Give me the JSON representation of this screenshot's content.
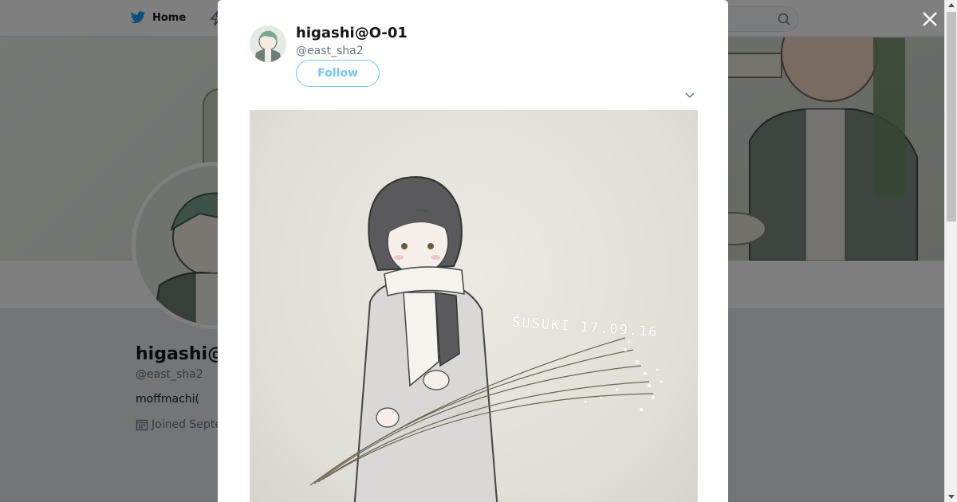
{
  "nav": {
    "home_label": "Home"
  },
  "profile": {
    "name_visible": "higashi@",
    "handle": "@east_sha2",
    "bio_visible": "moffmachi(",
    "joined_visible": "Joined Septe"
  },
  "tweet_modal": {
    "author_name": "higashi@O-01",
    "author_handle": "@east_sha2",
    "follow_label": "Follow",
    "image_caption": "SUSUKI 17.09.16"
  },
  "icons": {
    "close": "close-icon",
    "caret": "chevron-down-icon",
    "search": "search-icon",
    "bird": "twitter-bird-icon",
    "calendar": "calendar-icon"
  },
  "colors": {
    "brand": "#1da1f2",
    "text": "#14171a",
    "muted": "#657786"
  }
}
